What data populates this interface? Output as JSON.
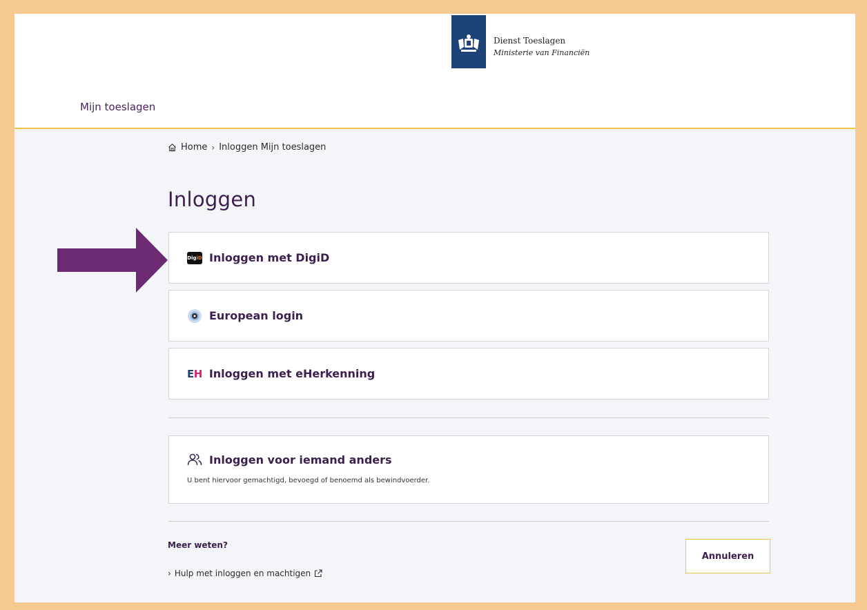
{
  "header": {
    "brand_name": "Dienst Toeslagen",
    "brand_sub": "Ministerie van Financiën",
    "site_title": "Mijn toeslagen"
  },
  "breadcrumb": {
    "home": "Home",
    "current": "Inloggen Mijn toeslagen"
  },
  "page_title": "Inloggen",
  "login_options": [
    {
      "label": "Inloggen met DigiD",
      "icon": "digid-icon"
    },
    {
      "label": "European login",
      "icon": "eu-login-icon"
    },
    {
      "label": "Inloggen met eHerkenning",
      "icon": "eherkenning-icon"
    }
  ],
  "icons": {
    "digid_dig": "Dig",
    "digid_id": "iD",
    "eh_e": "E",
    "eh_h": "H"
  },
  "other_login": {
    "label": "Inloggen voor iemand anders",
    "description": "U bent hiervoor gemachtigd, bevoegd of benoemd als bewindvoerder."
  },
  "more_info": {
    "heading": "Meer weten?",
    "link": "Hulp met inloggen en machtigen"
  },
  "cancel_label": "Annuleren",
  "colors": {
    "accent_purple": "#3b1f4d",
    "header_border": "#f0c44a",
    "logo_blue": "#1c4278",
    "arrow": "#6b2a72"
  }
}
